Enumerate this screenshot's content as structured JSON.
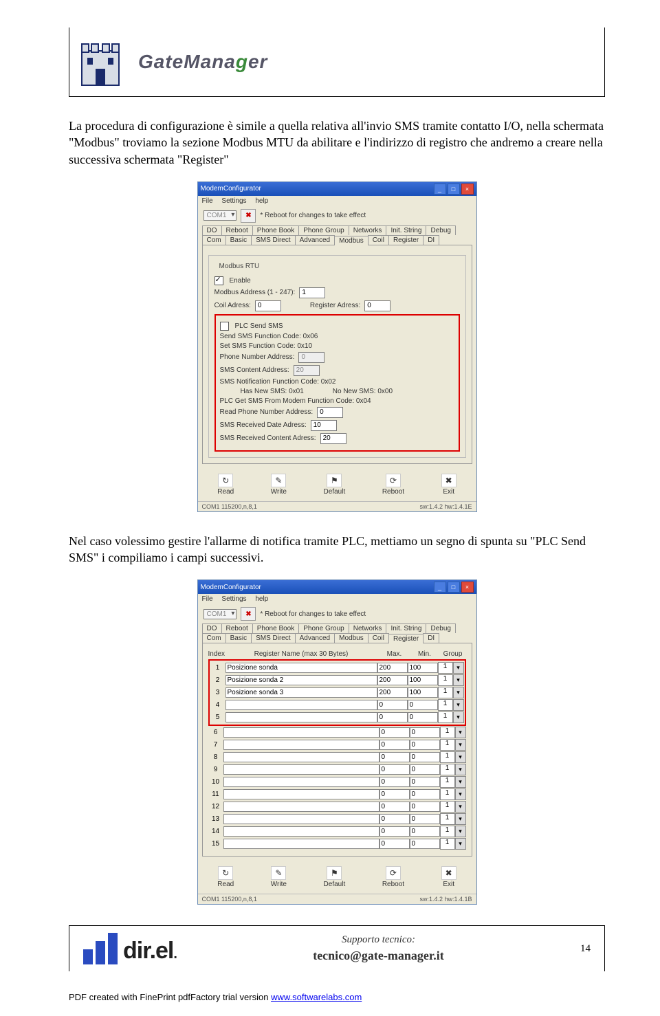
{
  "brand": {
    "pre": "GateMana",
    "g": "g",
    "post": "er"
  },
  "para1": "La procedura di configurazione è simile a quella relativa all'invio SMS tramite contatto I/O, nella schermata \"Modbus\" troviamo la sezione Modbus MTU da abilitare e l'indirizzo di registro che andremo a creare nella successiva schermata \"Register\"",
  "para2": "Nel caso volessimo gestire l'allarme di notifica tramite PLC, mettiamo un segno di spunta su \"PLC Send SMS\" i compiliamo i campi successivi.",
  "win": {
    "title": "ModemConfigurator",
    "menu": [
      "File",
      "Settings",
      "help"
    ],
    "com": "COM1",
    "reboot_note": "* Reboot for changes to take effect",
    "tabs_row1": [
      "DO",
      "Reboot",
      "Phone Book",
      "Phone Group",
      "Networks",
      "Init. String",
      "Debug"
    ],
    "tabs_row2": [
      "Com",
      "Basic",
      "SMS Direct",
      "Advanced",
      "Modbus",
      "Coil",
      "Register",
      "DI"
    ],
    "status_left": "COM1 115200,n,8,1",
    "status_right_1": "sw:1.4.2 hw:1.4.1E",
    "status_right_2": "sw:1.4.2 hw:1.4.1B"
  },
  "modbus": {
    "fieldset": "Modbus RTU",
    "enable": "Enable",
    "addr_label": "Modbus Address (1 - 247):",
    "addr_val": "1",
    "coil_label": "Coil Adress:",
    "coil_val": "0",
    "reg_label": "Register Adress:",
    "reg_val": "0",
    "plc_send": "PLC Send SMS",
    "send_fc": "Send SMS Function Code: 0x06",
    "set_fc": "Set SMS Function Code: 0x10",
    "phone_addr": "Phone Number Address:",
    "phone_val": "0",
    "content_addr": "SMS Content Address:",
    "content_val": "20",
    "notif_fc": "SMS Notification Function Code: 0x02",
    "has_new": "Has New SMS: 0x01",
    "no_new": "No New SMS: 0x00",
    "get_fc": "PLC Get SMS From Modem Function Code: 0x04",
    "read_phone": "Read Phone Number Address:",
    "read_phone_val": "0",
    "recv_date": "SMS Received Date Adress:",
    "recv_date_val": "10",
    "recv_content": "SMS Received Content Adress:",
    "recv_content_val": "20"
  },
  "buttons": {
    "read": "Read",
    "write": "Write",
    "default": "Default",
    "reboot": "Reboot",
    "exit": "Exit"
  },
  "register": {
    "headers": {
      "index": "Index",
      "name": "Register Name (max 30 Bytes)",
      "max": "Max.",
      "min": "Min.",
      "group": "Group"
    },
    "rows": [
      {
        "i": "1",
        "name": "Posizione sonda",
        "max": "200",
        "min": "100",
        "g": "1"
      },
      {
        "i": "2",
        "name": "Posizione sonda 2",
        "max": "200",
        "min": "100",
        "g": "1"
      },
      {
        "i": "3",
        "name": "Posizione sonda 3",
        "max": "200",
        "min": "100",
        "g": "1"
      },
      {
        "i": "4",
        "name": "",
        "max": "0",
        "min": "0",
        "g": "1"
      },
      {
        "i": "5",
        "name": "",
        "max": "0",
        "min": "0",
        "g": "1"
      },
      {
        "i": "6",
        "name": "",
        "max": "0",
        "min": "0",
        "g": "1"
      },
      {
        "i": "7",
        "name": "",
        "max": "0",
        "min": "0",
        "g": "1"
      },
      {
        "i": "8",
        "name": "",
        "max": "0",
        "min": "0",
        "g": "1"
      },
      {
        "i": "9",
        "name": "",
        "max": "0",
        "min": "0",
        "g": "1"
      },
      {
        "i": "10",
        "name": "",
        "max": "0",
        "min": "0",
        "g": "1"
      },
      {
        "i": "11",
        "name": "",
        "max": "0",
        "min": "0",
        "g": "1"
      },
      {
        "i": "12",
        "name": "",
        "max": "0",
        "min": "0",
        "g": "1"
      },
      {
        "i": "13",
        "name": "",
        "max": "0",
        "min": "0",
        "g": "1"
      },
      {
        "i": "14",
        "name": "",
        "max": "0",
        "min": "0",
        "g": "1"
      },
      {
        "i": "15",
        "name": "",
        "max": "0",
        "min": "0",
        "g": "1"
      }
    ]
  },
  "footer": {
    "supporto": "Supporto tecnico:",
    "email": "tecnico@gate-manager.it",
    "page": "14"
  },
  "pdfnote": {
    "pre": "PDF created with FinePrint pdfFactory trial version ",
    "link": "www.softwarelabs.com"
  }
}
